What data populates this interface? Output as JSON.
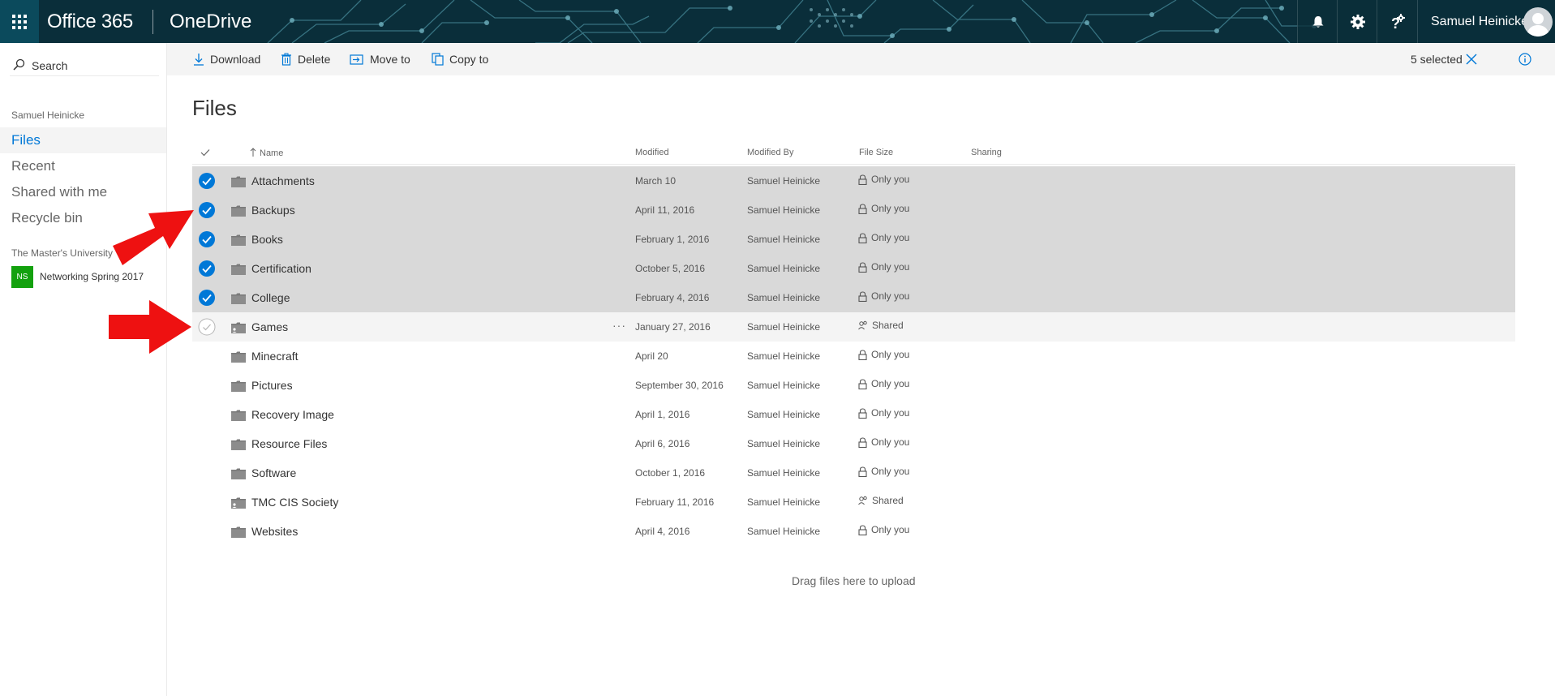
{
  "suite": {
    "brand": "Office 365",
    "app": "OneDrive",
    "user_name": "Samuel Heinicke",
    "icons": [
      "waffle-icon",
      "bell-icon",
      "gear-icon",
      "help-icon",
      "avatar"
    ]
  },
  "leftnav": {
    "search_label": "Search",
    "user_label": "Samuel Heinicke",
    "items": [
      {
        "label": "Files",
        "active": true
      },
      {
        "label": "Recent",
        "active": false
      },
      {
        "label": "Shared with me",
        "active": false
      },
      {
        "label": "Recycle bin",
        "active": false
      }
    ],
    "org_label": "The Master's University",
    "group": {
      "badge": "NS",
      "label": "Networking Spring 2017",
      "color": "#13a10e"
    }
  },
  "commandbar": {
    "download": "Download",
    "delete": "Delete",
    "move_to": "Move to",
    "copy_to": "Copy to",
    "selected_count": "5 selected"
  },
  "main": {
    "title": "Files",
    "columns": {
      "name": "Name",
      "modified": "Modified",
      "modified_by": "Modified By",
      "file_size": "File Size",
      "sharing": "Sharing"
    },
    "rows": [
      {
        "name": "Attachments",
        "modified": "March 10",
        "modified_by": "Samuel Heinicke",
        "sharing": "Only you",
        "selected": true
      },
      {
        "name": "Backups",
        "modified": "April 11, 2016",
        "modified_by": "Samuel Heinicke",
        "sharing": "Only you",
        "selected": true
      },
      {
        "name": "Books",
        "modified": "February 1, 2016",
        "modified_by": "Samuel Heinicke",
        "sharing": "Only you",
        "selected": true
      },
      {
        "name": "Certification",
        "modified": "October 5, 2016",
        "modified_by": "Samuel Heinicke",
        "sharing": "Only you",
        "selected": true
      },
      {
        "name": "College",
        "modified": "February 4, 2016",
        "modified_by": "Samuel Heinicke",
        "sharing": "Only you",
        "selected": true
      },
      {
        "name": "Games",
        "modified": "January 27, 2016",
        "modified_by": "Samuel Heinicke",
        "sharing": "Shared",
        "selected": false,
        "hover": true,
        "more": "···"
      },
      {
        "name": "Minecraft",
        "modified": "April 20",
        "modified_by": "Samuel Heinicke",
        "sharing": "Only you",
        "selected": false
      },
      {
        "name": "Pictures",
        "modified": "September 30, 2016",
        "modified_by": "Samuel Heinicke",
        "sharing": "Only you",
        "selected": false
      },
      {
        "name": "Recovery Image",
        "modified": "April 1, 2016",
        "modified_by": "Samuel Heinicke",
        "sharing": "Only you",
        "selected": false
      },
      {
        "name": "Resource Files",
        "modified": "April 6, 2016",
        "modified_by": "Samuel Heinicke",
        "sharing": "Only you",
        "selected": false
      },
      {
        "name": "Software",
        "modified": "October 1, 2016",
        "modified_by": "Samuel Heinicke",
        "sharing": "Only you",
        "selected": false
      },
      {
        "name": "TMC CIS Society",
        "modified": "February 11, 2016",
        "modified_by": "Samuel Heinicke",
        "sharing": "Shared",
        "selected": false
      },
      {
        "name": "Websites",
        "modified": "April 4, 2016",
        "modified_by": "Samuel Heinicke",
        "sharing": "Only you",
        "selected": false
      }
    ],
    "drop_hint": "Drag files here to upload"
  },
  "colors": {
    "accent": "#0078d7",
    "suitebar": "#0a2e3a",
    "selected_row": "#d9d9d9",
    "annotation_arrow": "#ee1111"
  }
}
